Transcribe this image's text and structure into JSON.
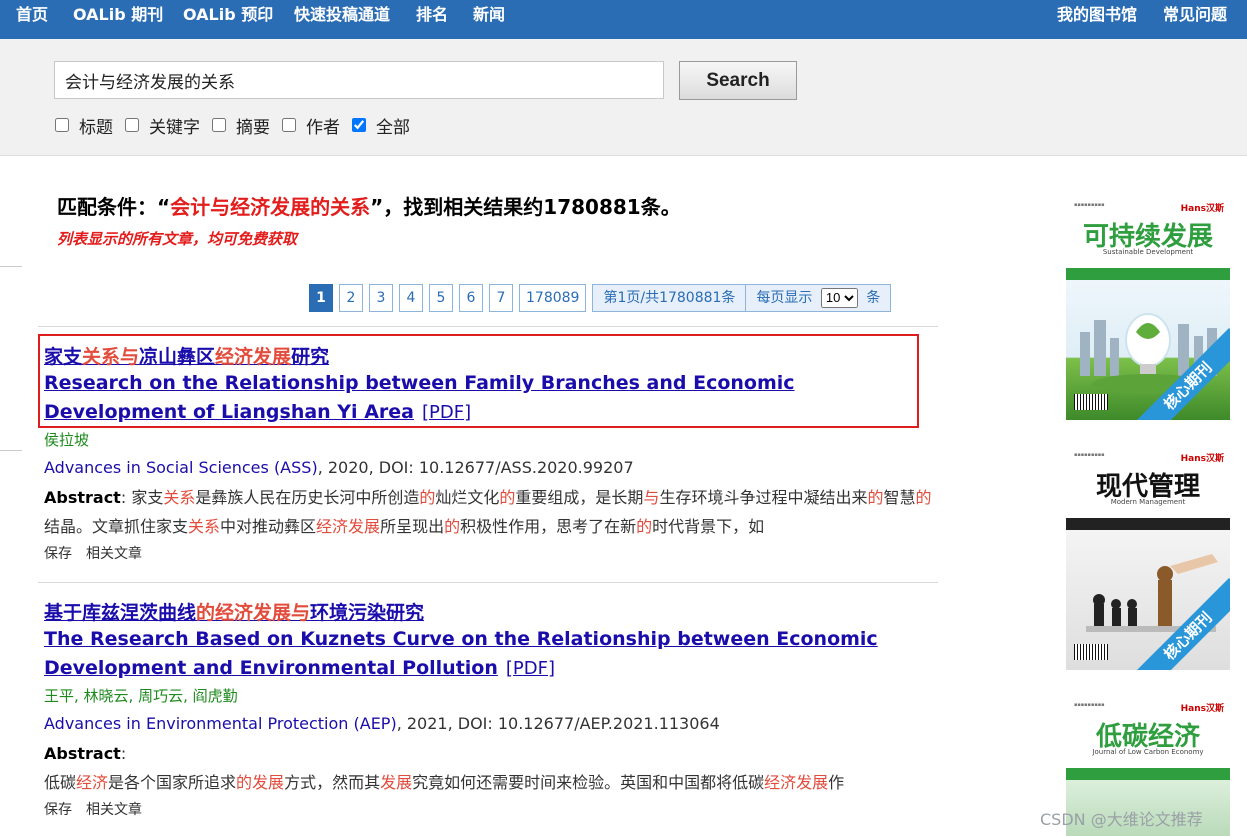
{
  "nav": {
    "left": [
      "首页",
      "OALib 期刊",
      "OALib 预印",
      "快速投稿通道",
      "排名",
      "新闻"
    ],
    "right": [
      "我的图书馆",
      "常见问题"
    ]
  },
  "search": {
    "query": "会计与经济发展的关系",
    "button": "Search",
    "filters": [
      {
        "label": "标题",
        "checked": false
      },
      {
        "label": "关键字",
        "checked": false
      },
      {
        "label": "摘要",
        "checked": false
      },
      {
        "label": "作者",
        "checked": false
      },
      {
        "label": "全部",
        "checked": true
      }
    ]
  },
  "summary": {
    "prefix": "匹配条件：“",
    "keyword": "会计与经济发展的关系",
    "suffix": "”，找到相关结果约1780881条。",
    "free_note": "列表显示的所有文章，均可免费获取"
  },
  "pagination": {
    "pages": [
      "1",
      "2",
      "3",
      "4",
      "5",
      "6",
      "7",
      "178089"
    ],
    "active": "1",
    "info": "第1页/共1780881条",
    "per_page_label": "每页显示",
    "per_page_value": "10",
    "per_page_unit": "条"
  },
  "results": [
    {
      "title_cn_parts": [
        "家支",
        "关系与",
        "凉山彝区",
        "经济发展",
        "研究"
      ],
      "title_en": "Research on the Relationship between Family Branches and Economic Development of Liangshan Yi Area",
      "pdf": "[PDF]",
      "authors": "侯拉坡",
      "journal": "Advances in Social Sciences (ASS)",
      "meta": ", 2020, DOI: 10.12677/ASS.2020.99207",
      "abstract_label": "Abstract",
      "abstract_parts": [
        "家支",
        "关系",
        "是彝族人民在历史长河中所创造",
        "的",
        "灿烂文化",
        "的",
        "重要组成，是长期",
        "与",
        "生存环境斗争过程中凝结出来",
        "的",
        "智慧",
        "的",
        "结晶。文章抓住家支",
        "关系",
        "中对推动彝区",
        "经济发展",
        "所呈现出",
        "的",
        "积极性作用，思考了在新",
        "的",
        "时代背景下，如"
      ],
      "actions": [
        "保存",
        "相关文章"
      ]
    },
    {
      "title_cn_parts": [
        "基于库兹涅茨曲线",
        "的经济发展与",
        "环境污染研究"
      ],
      "title_en": "The Research Based on Kuznets Curve on the Relationship between Economic Development and Environmental Pollution",
      "pdf": "[PDF]",
      "authors": "王平, 林晓云, 周巧云, 阎虎勤",
      "journal": "Advances in Environmental Protection (AEP)",
      "meta": ", 2021, DOI: 10.12677/AEP.2021.113064",
      "abstract_label": "Abstract",
      "abstract_parts": [
        "低碳",
        "经济",
        "是各个国家所追求",
        "的发展",
        "方式，然而其",
        "发展",
        "究竟如何还需要时间来检验。英国和中国都将低碳",
        "经济发展",
        "作"
      ],
      "actions": [
        "保存",
        "相关文章"
      ]
    }
  ],
  "covers": [
    {
      "title": "可持续发展",
      "subtitle": "Sustainable Development",
      "ribbon": "核心期刊",
      "color": "#2f9e3f"
    },
    {
      "title": "现代管理",
      "subtitle": "Modern Management",
      "ribbon": "核心期刊",
      "color": "#222222"
    },
    {
      "title": "低碳经济",
      "subtitle": "Journal of Low Carbon Economy",
      "ribbon": "",
      "color": "#2f9e3f"
    }
  ],
  "watermark": "CSDN @大维论文推荐"
}
